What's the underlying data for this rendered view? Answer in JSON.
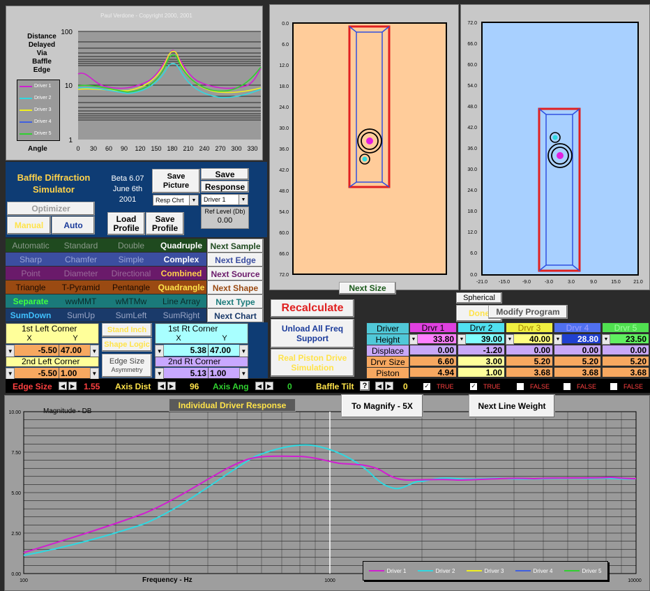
{
  "copyright": "Paul Verdone - Copyright 2000, 2001",
  "top_chart": {
    "side_label": [
      "Distance",
      "Delayed",
      "Via",
      "Baffle",
      "Edge"
    ],
    "angle_label": "Angle",
    "y_ticks": [
      "100",
      "10",
      "1"
    ],
    "x_ticks": [
      "0",
      "30",
      "60",
      "90",
      "120",
      "150",
      "180",
      "210",
      "240",
      "270",
      "300",
      "330"
    ],
    "legend": [
      "Driver 1",
      "Driver 2",
      "Driver 3",
      "Driver 4",
      "Driver 5"
    ],
    "legend_colors": [
      "#d020d0",
      "#30d8e0",
      "#f0f020",
      "#4060e0",
      "#30d030"
    ]
  },
  "app": {
    "title": "Baffle Diffraction Simulator",
    "version": "Beta 6.07",
    "date": "June 6th",
    "year": "2001"
  },
  "buttons": {
    "save_picture": "Save Picture",
    "save": "Save",
    "response": "Response",
    "resp_chart_dd": "Resp Chrt",
    "driver_dd": "Driver 1",
    "ref_level_label": "Ref Level (Db)",
    "ref_level_value": "0.00",
    "optimizer": "Optimizer",
    "manual": "Manual",
    "auto": "Auto",
    "load_profile": "Load Profile",
    "save_profile": "Save Profile",
    "recalculate": "Recalculate",
    "unload": "Unload All Freq Support",
    "real_piston": "Real Piston Drive Simulation",
    "next_size": "Next Size",
    "spherical": "Spherical",
    "done": "Done",
    "modify_program": "Modify Program",
    "individual_driver_response": "Individual Driver Response",
    "to_magnify": "To Magnify - 5X",
    "next_line_weight": "Next Line Weight"
  },
  "option_rows": [
    {
      "items": [
        "Automatic",
        "Standard",
        "Double",
        "Quadruple"
      ],
      "bg": "#1f4a1f",
      "fg": "#8a9a8a",
      "active": 3,
      "active_color": "#ffffff",
      "side": "Next Sample",
      "side_color": "#1f4a1f"
    },
    {
      "items": [
        "Sharp",
        "Chamfer",
        "Simple",
        "Complex"
      ],
      "bg": "#3b4ea0",
      "fg": "#9aa6d6",
      "active": 3,
      "active_color": "#ffffff",
      "side": "Next Edge",
      "side_color": "#3b4ea0"
    },
    {
      "items": [
        "Point",
        "Diameter",
        "Directional",
        "Combined"
      ],
      "bg": "#6a1a6a",
      "fg": "#9a6a9a",
      "active": 3,
      "active_color": "#ffd24a",
      "side": "Next Source",
      "side_color": "#6a1a6a"
    },
    {
      "items": [
        "Triangle",
        "T-Pyramid",
        "Pentangle",
        "Quadrangle"
      ],
      "bg": "#9a4a12",
      "fg": "#1a0a00",
      "active": 3,
      "active_color": "#ffe34a",
      "side": "Next Shape",
      "side_color": "#9a4a12"
    },
    {
      "items": [
        "Separate",
        "wwMMT",
        "wMTMw",
        "Line Array"
      ],
      "bg": "#1a7a7a",
      "fg": "#0a2a2a",
      "active": 0,
      "active_color": "#40ff40",
      "side": "Next Type",
      "side_color": "#1a7a7a"
    },
    {
      "items": [
        "SumDown",
        "SumUp",
        "SumLeft",
        "SumRight"
      ],
      "bg": "#1a3a6a",
      "fg": "#9aa6c6",
      "active": 0,
      "active_color": "#40c0ff",
      "side": "Next Chart",
      "side_color": "#1a3a6a"
    }
  ],
  "corners": {
    "first_left": "1st Left Corner",
    "x": "X",
    "y": "Y",
    "fl_x": "-5.50",
    "fl_y": "47.00",
    "second_left": "2nd Left Corner",
    "sl_x": "-5.50",
    "sl_y": "1.00",
    "stand_inch": "Stand Inch",
    "shape_logic": "Shape Logic",
    "edge_size_asym": "Edge Size",
    "asymmetry": "Asymmetry",
    "first_rt": "1st Rt Corner",
    "fr_x": "5.38",
    "fr_y": "47.00",
    "second_rt": "2nd Rt Corner",
    "sr_x": "5.13",
    "sr_y": "1.00"
  },
  "driver_table": {
    "rows": [
      "Driver",
      "Height",
      "Displace",
      "Drvr Size",
      "Piston"
    ],
    "headers": [
      "Drvr 1",
      "Drvr 2",
      "Drvr 3",
      "Drvr 4",
      "Drvr 5"
    ],
    "header_bg": [
      "#e040e0",
      "#50e0f0",
      "#f0f040",
      "#5070f0",
      "#50e050"
    ],
    "header_fg": [
      "#000000",
      "#000000",
      "#a08000",
      "#a0a0ff",
      "#a0ffa0"
    ],
    "height": [
      "33.80",
      "39.00",
      "40.00",
      "28.80",
      "23.50"
    ],
    "height_bg": [
      "#ff80ff",
      "#80ffff",
      "#ffff80",
      "#2040d0",
      "#60f060"
    ],
    "displace": [
      "0.00",
      "-1.20",
      "0.00",
      "0.00",
      "0.00"
    ],
    "drvr_size": [
      "6.60",
      "3.00",
      "5.20",
      "5.20",
      "5.20"
    ],
    "piston": [
      "4.94",
      "1.00",
      "3.68",
      "3.68",
      "3.68"
    ]
  },
  "bottom_bar": {
    "edge_size_label": "Edge Size",
    "edge_size_value": "1.55",
    "axis_dist_label": "Axis Dist",
    "axis_dist_value": "96",
    "axis_ang_label": "Axis Ang",
    "axis_ang_value": "0",
    "baffle_tilt_label": "Baffle Tilt",
    "q": "?",
    "baffle_tilt_value": "0",
    "checks": [
      "TRUE",
      "TRUE",
      "FALSE",
      "FALSE",
      "FALSE"
    ],
    "checked": [
      true,
      true,
      false,
      false,
      false
    ]
  },
  "baffle_front": {
    "y_ticks": [
      "0.0",
      "6.0",
      "12.0",
      "18.0",
      "24.0",
      "30.0",
      "36.0",
      "42.0",
      "48.0",
      "54.0",
      "60.0",
      "66.0",
      "72.0"
    ]
  },
  "baffle_side": {
    "y_ticks": [
      "72.0",
      "66.0",
      "60.0",
      "54.0",
      "48.0",
      "42.0",
      "36.0",
      "30.0",
      "24.0",
      "18.0",
      "12.0",
      "6.0",
      "0.0"
    ],
    "x_ticks": [
      "-21.0",
      "-15.0",
      "-9.0",
      "-3.0",
      "3.0",
      "9.0",
      "15.0",
      "21.0"
    ]
  },
  "freq_chart": {
    "ylabel": "Magnitude - DB",
    "xlabel": "Frequency - Hz",
    "y_ticks": [
      "10.00",
      "7.50",
      "5.00",
      "2.50",
      "0.00"
    ],
    "x_ticks": [
      "100",
      "1000",
      "10000"
    ],
    "legend": [
      "Driver 1",
      "Driver 2",
      "Driver 3",
      "Driver 4",
      "Driver 5"
    ]
  }
}
